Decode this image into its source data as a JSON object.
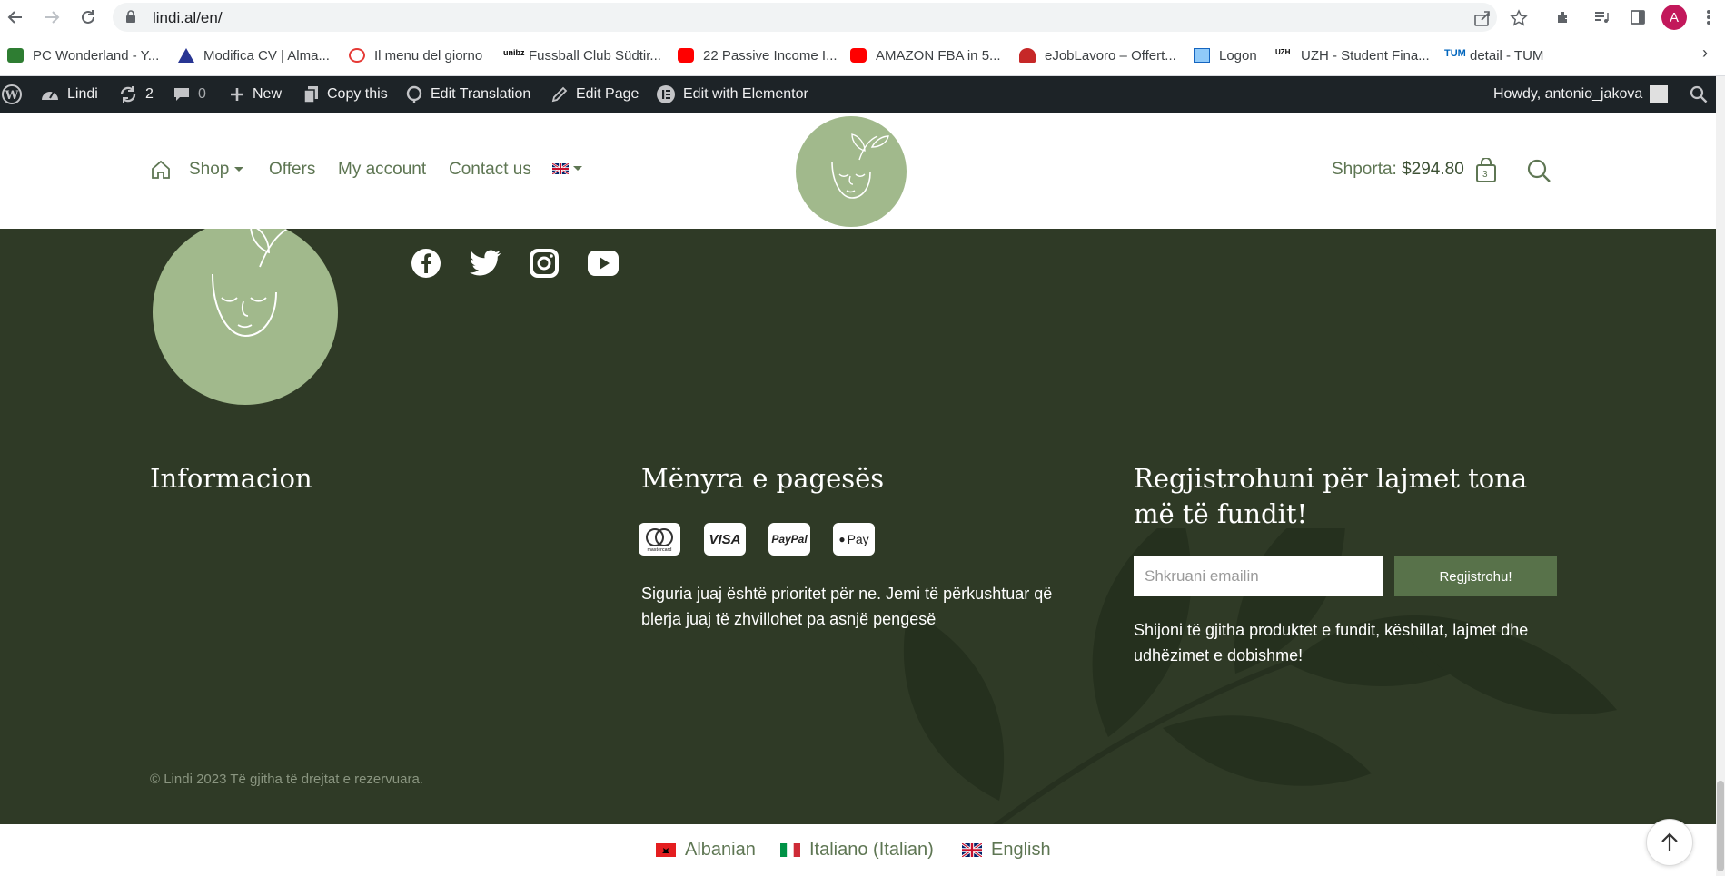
{
  "browser": {
    "url": "lindi.al/en/",
    "profile_initial": "A"
  },
  "bookmarks": [
    {
      "label": "PC Wonderland - Y...",
      "icon": "pc-wonderland-icon",
      "color": "#2e7d32"
    },
    {
      "label": "Modifica CV | Alma...",
      "icon": "almalaurea-icon",
      "color": "#283593"
    },
    {
      "label": "Il menu del giorno",
      "icon": "menu-icon",
      "color": "#e53935"
    },
    {
      "label": "Fussball Club Südtir...",
      "icon": "unibz-icon",
      "color": "#000000"
    },
    {
      "label": "22 Passive Income I...",
      "icon": "youtube-icon",
      "color": "#ff0000"
    },
    {
      "label": "AMAZON FBA in 5...",
      "icon": "youtube-icon",
      "color": "#ff0000"
    },
    {
      "label": "eJobLavoro – Offert...",
      "icon": "ejoblavoro-icon",
      "color": "#c62828"
    },
    {
      "label": "Logon",
      "icon": "logon-icon",
      "color": "#1565c0"
    },
    {
      "label": "UZH - Student Fina...",
      "icon": "uzh-icon",
      "color": "#000000"
    },
    {
      "label": "detail - TUM",
      "icon": "tum-icon",
      "color": "#0065bd"
    }
  ],
  "admin_bar": {
    "site": "Lindi",
    "updates": "2",
    "comments": "0",
    "new": "New",
    "copy": "Copy this",
    "edit_translation": "Edit Translation",
    "edit_page": "Edit Page",
    "elementor": "Edit with Elementor",
    "howdy": "Howdy, antonio_jakova"
  },
  "header": {
    "menu": {
      "shop": "Shop",
      "offers": "Offers",
      "account": "My account",
      "contact": "Contact us"
    },
    "cart_label": "Shporta:",
    "cart_amount": "$294.80",
    "cart_count": "3"
  },
  "footer": {
    "info_heading": "Informacion",
    "payment_heading": "Mënyra e pagesës",
    "payment_methods": [
      "mastercard",
      "VISA",
      "PayPal",
      "Pay"
    ],
    "mastercard_small": "mastercard",
    "payment_text": "Siguria juaj është prioritet për ne. Jemi të përkushtuar që blerja juaj të zhvillohet pa asnjë pengesë",
    "newsletter_heading": "Regjistrohuni për lajmet tona më të fundit!",
    "email_placeholder": "Shkruani emailin",
    "subscribe_label": "Regjistrohu!",
    "newsletter_text": "Shijoni të gjitha produktet e fundit, këshillat, lajmet dhe udhëzimet e dobishme!",
    "copyright": "© Lindi 2023 Të gjitha të drejtat e rezervuara."
  },
  "languages": [
    {
      "label": "Albanian",
      "flag": "albania-flag"
    },
    {
      "label": "Italiano (Italian)",
      "flag": "italy-flag"
    },
    {
      "label": "English",
      "flag": "uk-flag"
    }
  ],
  "colors": {
    "brand_green": "#5e7653",
    "footer_bg": "#2f3a26",
    "logo_bg": "#a1b98c",
    "button_bg": "#58724a"
  }
}
